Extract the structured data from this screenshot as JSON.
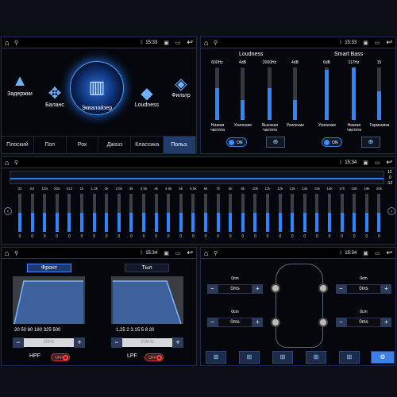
{
  "status": {
    "time1": "15:33",
    "time2": "15:34"
  },
  "colors": {
    "accent": "#2c86ff",
    "active_tab": "#1f3c6a",
    "off_red": "#cc3333"
  },
  "icons": {
    "home": "home-icon",
    "back": "back-icon",
    "location": "location-icon",
    "bluetooth": "bluetooth-icon"
  },
  "panel1": {
    "modes": [
      "Задержки",
      "Баланс",
      "Эквалайзер",
      "Loudness",
      "Фильтр"
    ],
    "presets": [
      "Плоский",
      "Поп",
      "Рок",
      "Джазз",
      "Классика",
      "Польз."
    ],
    "active_preset": 5
  },
  "panel2": {
    "loudness_title": "Loudness",
    "smartbass_title": "Smart Bass",
    "top_values": [
      "600Hz",
      "4dB",
      "2000Hz",
      "4dB",
      "6dB",
      "117Hz",
      "15"
    ],
    "labels": [
      "Низкая частота",
      "Усиление",
      "Высокая частота",
      "Усиление",
      "Усиление",
      "Низкая частота",
      "Гармоника"
    ],
    "fill_levels": [
      0.6,
      0.38,
      0.6,
      0.38,
      0.95,
      1.0,
      0.55
    ],
    "toggle_label": "ON"
  },
  "panel3": {
    "scale": [
      "12",
      "0",
      "-12"
    ],
    "bands": [
      "32",
      "64",
      "128",
      "256",
      "512",
      "1k",
      "1.3k",
      "2k",
      "2.5k",
      "3k",
      "3.5k",
      "4k",
      "4.5k",
      "5k",
      "5.5k",
      "6k",
      "7k",
      "8k",
      "9k",
      "10k",
      "11k",
      "12k",
      "13k",
      "14k",
      "15k",
      "16k",
      "17k",
      "18k",
      "19k",
      "20k"
    ],
    "values": [
      "0",
      "0",
      "0",
      "0",
      "0",
      "0",
      "0",
      "0",
      "0",
      "0",
      "0",
      "0",
      "0",
      "0",
      "0",
      "0",
      "0",
      "0",
      "0",
      "0",
      "0",
      "0",
      "0",
      "0",
      "0",
      "0",
      "0",
      "0",
      "0",
      "0"
    ]
  },
  "panel4": {
    "front": "Фронт",
    "rear": "Тыл",
    "hpf_ticks": "20  50  80  180 325  500",
    "lpf_ticks": "1.25  2  3.15  5  8  20",
    "hpf_value": "20Hz",
    "lpf_value": "20kHz",
    "hpf": "HPF",
    "lpf": "LPF",
    "off": "OFF"
  },
  "panel5": {
    "channels": [
      {
        "cm": "0cm",
        "ms": "0ms"
      },
      {
        "cm": "0cm",
        "ms": "0ms"
      },
      {
        "cm": "0cm",
        "ms": "0ms"
      },
      {
        "cm": "0cm",
        "ms": "0ms"
      }
    ],
    "minus": "−",
    "plus": "+"
  }
}
